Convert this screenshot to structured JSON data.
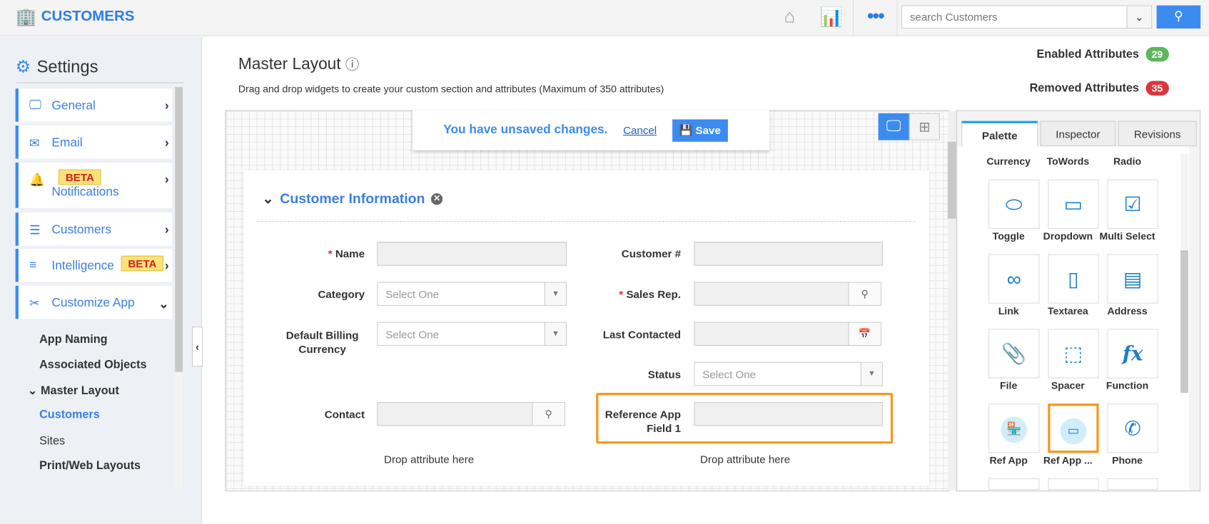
{
  "header": {
    "app_title": "CUSTOMERS",
    "search_placeholder": "search Customers",
    "more_icon": "more-dots-icon"
  },
  "sidebar": {
    "title": "Settings",
    "items": [
      {
        "label": "General",
        "icon": "monitor-icon"
      },
      {
        "label": "Email",
        "icon": "envelope-icon"
      },
      {
        "label": "Notifications",
        "icon": "bell-icon",
        "badge": "BETA"
      },
      {
        "label": "Customers",
        "icon": "list-icon"
      },
      {
        "label": "Intelligence",
        "icon": "lines-icon",
        "badge": "BETA"
      },
      {
        "label": "Customize App",
        "icon": "tools-icon"
      }
    ],
    "sub_items": [
      "App Naming",
      "Associated Objects",
      "Master Layout",
      "Customers",
      "Sites",
      "Print/Web Layouts"
    ]
  },
  "main": {
    "title": "Master Layout",
    "description": "Drag and drop widgets to create your custom section and attributes (Maximum of 350 attributes)",
    "enabled_label": "Enabled Attributes",
    "enabled_count": "29",
    "removed_label": "Removed Attributes",
    "removed_count": "35",
    "unsaved": {
      "message": "You have unsaved changes.",
      "cancel": "Cancel",
      "save": "Save"
    }
  },
  "form": {
    "section": "Customer Information",
    "fields": {
      "name": "Name",
      "customer_no": "Customer #",
      "category": "Category",
      "sales_rep": "Sales Rep.",
      "billing": "Default Billing Currency",
      "last_contacted": "Last Contacted",
      "status": "Status",
      "contact": "Contact",
      "ref_app": "Reference App Field 1"
    },
    "select_placeholder": "Select One",
    "drop_text": "Drop attribute here"
  },
  "palette": {
    "tabs": [
      "Palette",
      "Inspector",
      "Revisions"
    ],
    "top_labels": [
      "Currency",
      "ToWords",
      "Radio"
    ],
    "widgets": [
      {
        "label": "Toggle",
        "icon": "toggle-icon"
      },
      {
        "label": "Dropdown",
        "icon": "dropdown-icon"
      },
      {
        "label": "Multi Select",
        "icon": "multi-select-icon"
      },
      {
        "label": "Link",
        "icon": "link-icon"
      },
      {
        "label": "Textarea",
        "icon": "textarea-icon"
      },
      {
        "label": "Address",
        "icon": "address-icon"
      },
      {
        "label": "File",
        "icon": "paperclip-icon"
      },
      {
        "label": "Spacer",
        "icon": "spacer-icon"
      },
      {
        "label": "Function",
        "icon": "function-icon",
        "glyph": "fx"
      },
      {
        "label": "Ref App",
        "icon": "ref-app-icon"
      },
      {
        "label": "Ref App ...",
        "icon": "ref-app-field-icon"
      },
      {
        "label": "Phone",
        "icon": "phone-icon"
      }
    ]
  },
  "colors": {
    "accent": "#3b8bf0",
    "enabled": "#5cb85c",
    "removed": "#d9363e",
    "highlight": "#f7961c"
  }
}
